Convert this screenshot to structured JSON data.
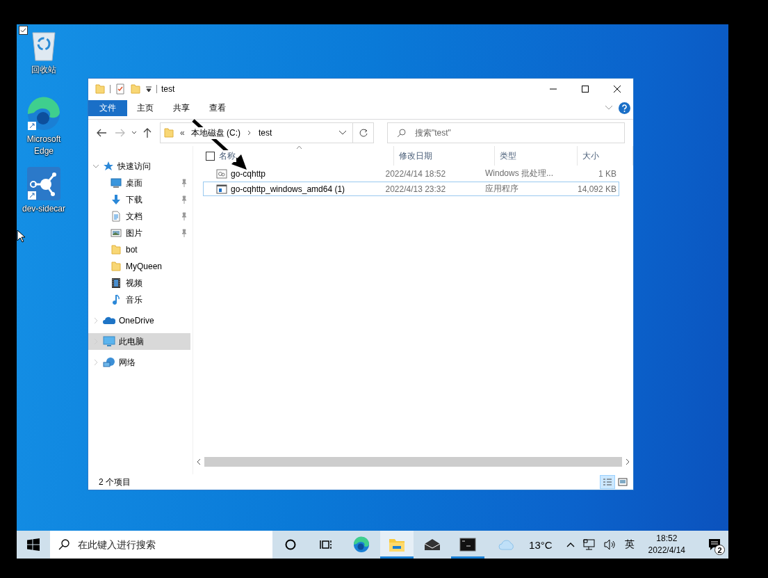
{
  "desktop_icons": [
    {
      "label": "回收站",
      "kind": "recycle-bin",
      "selected": true
    },
    {
      "label": "Microsoft Edge",
      "kind": "edge",
      "selected": false
    },
    {
      "label": "dev-sidecar",
      "kind": "app",
      "selected": false
    }
  ],
  "window": {
    "title": "test",
    "ribbon_tabs": [
      {
        "label": "文件",
        "kind": "file"
      },
      {
        "label": "主页",
        "kind": "tab"
      },
      {
        "label": "共享",
        "kind": "tab"
      },
      {
        "label": "查看",
        "kind": "tab"
      }
    ],
    "address": {
      "overflow": "«",
      "crumbs": [
        "本地磁盘 (C:)",
        "test"
      ]
    },
    "search": {
      "placeholder": "搜索\"test\""
    },
    "nav_tree": [
      {
        "label": "快速访问",
        "kind": "star",
        "expanded": true,
        "selected": false,
        "children": [
          {
            "label": "桌面",
            "kind": "desktop",
            "pinned": true,
            "selected": false
          },
          {
            "label": "下载",
            "kind": "download",
            "pinned": true,
            "selected": false
          },
          {
            "label": "文档",
            "kind": "document",
            "pinned": true,
            "selected": false
          },
          {
            "label": "图片",
            "kind": "picture",
            "pinned": true,
            "selected": false
          },
          {
            "label": "bot",
            "kind": "folder",
            "pinned": false,
            "selected": false
          },
          {
            "label": "MyQueen",
            "kind": "folder",
            "pinned": false,
            "selected": false
          },
          {
            "label": "视频",
            "kind": "video",
            "pinned": false,
            "selected": false
          },
          {
            "label": "音乐",
            "kind": "music",
            "pinned": false,
            "selected": false
          }
        ]
      },
      {
        "label": "OneDrive",
        "kind": "cloud",
        "expanded": false,
        "selected": false
      },
      {
        "label": "此电脑",
        "kind": "pc",
        "expanded": false,
        "selected": true
      },
      {
        "label": "网络",
        "kind": "network",
        "expanded": false,
        "selected": false
      }
    ],
    "columns": [
      {
        "label": "名称",
        "sorted": true
      },
      {
        "label": "修改日期",
        "sorted": false
      },
      {
        "label": "类型",
        "sorted": false
      },
      {
        "label": "大小",
        "sorted": false
      }
    ],
    "rows": [
      {
        "name": "go-cqhttp",
        "date": "2022/4/14 18:52",
        "type": "Windows 批处理...",
        "size": "1 KB",
        "kind": "batch",
        "focused": false
      },
      {
        "name": "go-cqhttp_windows_amd64 (1)",
        "date": "2022/4/13 23:32",
        "type": "应用程序",
        "size": "14,092 KB",
        "kind": "exe",
        "focused": true
      }
    ],
    "status_bar": {
      "item_count": "2 个项目"
    },
    "views": [
      {
        "kind": "details",
        "selected": true
      },
      {
        "kind": "tiles",
        "selected": false
      }
    ]
  },
  "taskbar": {
    "search": {
      "placeholder": "在此键入进行搜索"
    },
    "apps": [
      {
        "kind": "cortana",
        "running": false,
        "active": false
      },
      {
        "kind": "taskview",
        "running": false,
        "active": false
      },
      {
        "kind": "edge",
        "running": false,
        "active": false
      },
      {
        "kind": "explorer",
        "running": true,
        "active": true
      },
      {
        "kind": "mail",
        "running": false,
        "active": false
      },
      {
        "kind": "terminal",
        "running": true,
        "active": false
      }
    ],
    "weather": "13°C",
    "input_method": "英",
    "time": "18:52",
    "date": "2022/4/14",
    "notifications": "2"
  }
}
